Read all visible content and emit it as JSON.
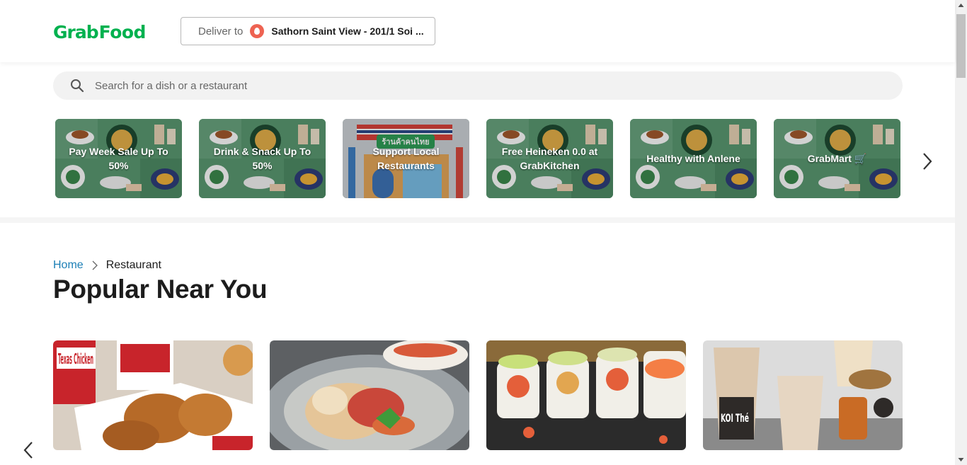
{
  "header": {
    "logo_grab": "Grab",
    "logo_food": "Food",
    "deliver_label": "Deliver to",
    "deliver_address": "Sathorn Saint View - 201/1 Soi ..."
  },
  "search": {
    "placeholder": "Search for a dish or a restaurant"
  },
  "promos": [
    {
      "label": "Pay Week Sale Up To 50%"
    },
    {
      "label": "Drink & Snack Up To 50%"
    },
    {
      "label": "Support Local Restaurants",
      "sign": "ร้านค้าคนไทย"
    },
    {
      "label": "Free Heineken 0.0 at GrabKitchen"
    },
    {
      "label": "Healthy with Anlene"
    },
    {
      "label": "GrabMart 🛒"
    }
  ],
  "breadcrumb": {
    "home": "Home",
    "current": "Restaurant"
  },
  "section_title": "Popular Near You",
  "restaurants": [
    {
      "image": "fried-chicken-photo",
      "logo_text": "Texas Chicken"
    },
    {
      "image": "seafood-stir-fry-photo"
    },
    {
      "image": "sushi-rolls-photo"
    },
    {
      "image": "bubble-tea-photo",
      "logo_text": "KOI Thé"
    }
  ],
  "colors": {
    "brand_green": "#00b14f",
    "link_blue": "#1c7fb6",
    "pin_red": "#ee6352"
  }
}
